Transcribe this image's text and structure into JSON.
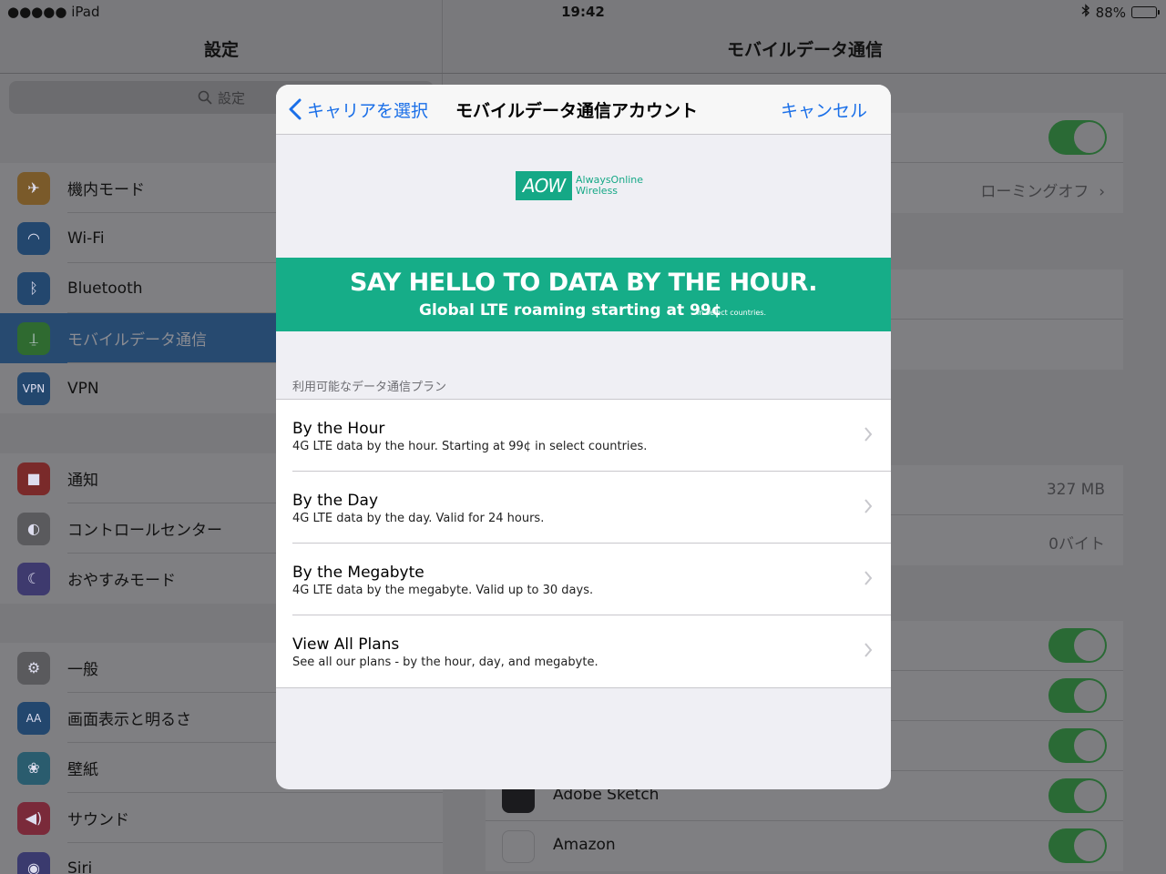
{
  "status_bar": {
    "carrier": "●●●●● iPad",
    "time": "19:42",
    "battery": "88%",
    "battery_level": 0.88
  },
  "left_pane": {
    "title": "設定",
    "search_placeholder": "設定",
    "groups": [
      [
        {
          "label": "機内モード",
          "icon": "airplane-icon",
          "color": "#7a5a2a"
        },
        {
          "label": "Wi-Fi",
          "icon": "wifi-icon",
          "color": "#23476e"
        },
        {
          "label": "Bluetooth",
          "icon": "bluetooth-icon",
          "color": "#23476e"
        },
        {
          "label": "モバイルデータ通信",
          "icon": "antenna-icon",
          "color": "#2f6a30",
          "selected": true
        },
        {
          "label": "VPN",
          "icon": "vpn-icon",
          "color": "#23476e"
        }
      ],
      [
        {
          "label": "通知",
          "icon": "notification-icon",
          "color": "#7a2a2a"
        },
        {
          "label": "コントロールセンター",
          "icon": "control-center-icon",
          "color": "#5a5a5d"
        },
        {
          "label": "おやすみモード",
          "icon": "moon-icon",
          "color": "#3e3a6e"
        }
      ],
      [
        {
          "label": "一般",
          "icon": "gear-icon",
          "color": "#5a5a5d"
        },
        {
          "label": "画面表示と明るさ",
          "icon": "display-icon",
          "color": "#23476e"
        },
        {
          "label": "壁紙",
          "icon": "wallpaper-icon",
          "color": "#2a5c6e"
        },
        {
          "label": "サウンド",
          "icon": "sound-icon",
          "color": "#7a2a3a"
        },
        {
          "label": "Siri",
          "icon": "siri-icon",
          "color": "#3a3a6e"
        }
      ]
    ]
  },
  "right_pane": {
    "title": "モバイルデータ通信",
    "roaming_value": "ローミングオフ",
    "usage_values": [
      "327 MB",
      "0バイト"
    ],
    "apps": [
      {
        "label": "Adobe Sketch"
      },
      {
        "label": "Amazon"
      }
    ]
  },
  "modal": {
    "back_label": "キャリアを選択",
    "title": "モバイルデータ通信アカウント",
    "cancel_label": "キャンセル",
    "logo": {
      "mark": "AOW",
      "line1": "AlwaysOnline",
      "line2": "Wireless"
    },
    "banner": {
      "headline": "SAY HELLO TO DATA BY THE HOUR.",
      "subline": "Global LTE roaming starting at 99¢",
      "note": "In select countries."
    },
    "colors": {
      "accent": "#16ad88",
      "link": "#1a6fe8"
    },
    "plans_header": "利用可能なデータ通信プラン",
    "plans": [
      {
        "title": "By the Hour",
        "desc": "4G LTE data by the hour. Starting at 99¢ in select countries."
      },
      {
        "title": "By the Day",
        "desc": "4G LTE data by the day. Valid for 24 hours."
      },
      {
        "title": "By the Megabyte",
        "desc": "4G LTE data by the megabyte. Valid up to 30 days."
      },
      {
        "title": "View All Plans",
        "desc": "See all our plans - by the hour, day, and megabyte."
      }
    ]
  }
}
